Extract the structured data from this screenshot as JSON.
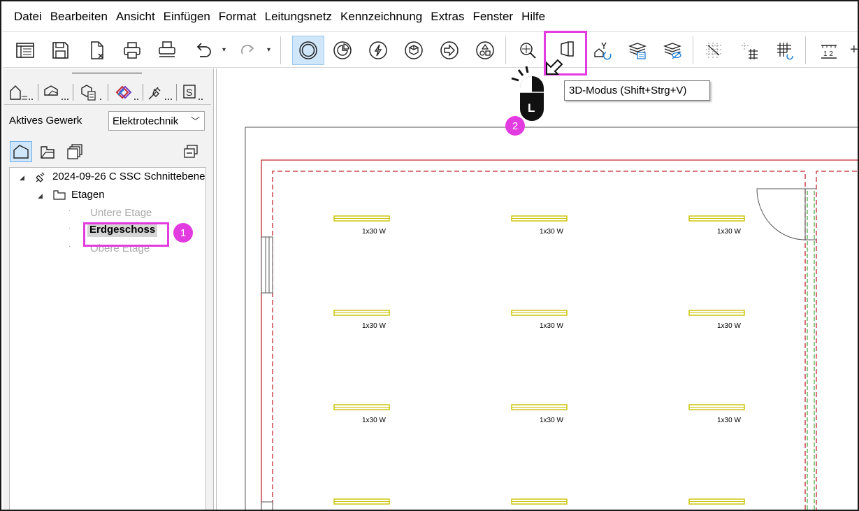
{
  "menu": [
    "Datei",
    "Bearbeiten",
    "Ansicht",
    "Einfügen",
    "Format",
    "Leitungsnetz",
    "Kennzeichnung",
    "Extras",
    "Fenster",
    "Hilfe"
  ],
  "toolbar": {
    "icons": [
      "document-list-icon",
      "save-icon",
      "close-document-icon",
      "print-icon",
      "print-preview-icon",
      "undo-icon",
      "redo-icon",
      "circle-mode-icon",
      "pie-segment-icon",
      "lightning-icon",
      "cube-icon",
      "arrow-right-circle-icon",
      "shapes-icon",
      "zoom-extents-icon",
      "3d-mode-icon",
      "symbol-swap-icon",
      "layers-list-icon",
      "layers-hide-icon",
      "grid-snap-icon",
      "grid-move-icon",
      "grid-refresh-icon",
      "ruler-icon"
    ],
    "tooltip": "3D-Modus (Shift+Strg+V)",
    "accent": "#e23ce0"
  },
  "left_panel": {
    "gewerk_label": "Aktives Gewerk",
    "gewerk_value": "Elektrotechnik",
    "tree": {
      "project": "2024-09-26 C SSC Schnittebene",
      "etagen": "Etagen",
      "floors": [
        "Untere Etage",
        "Erdgeschoss",
        "Obere Etage"
      ],
      "selected_floor": "Erdgeschoss"
    }
  },
  "annotations": {
    "step1": "1",
    "step2": "2",
    "mouse_button": "L"
  },
  "plan": {
    "lamp_label": "1x30 W",
    "wall_color": "#c0282f",
    "lamp_color": "#c9c200",
    "green_line": "#3aa33a"
  }
}
